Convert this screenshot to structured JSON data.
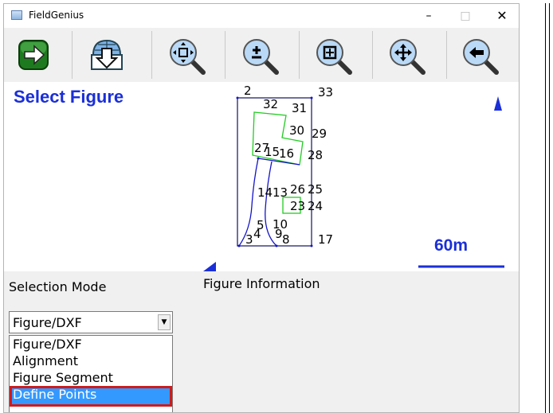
{
  "window": {
    "title": "FieldGenius"
  },
  "titlebar_buttons": {
    "minimize": "–",
    "maximize": "□",
    "close": "✕"
  },
  "toolbar": {
    "buttons": [
      {
        "name": "forward-arrow-icon"
      },
      {
        "name": "download-globe-icon"
      },
      {
        "name": "zoom-extents-icon"
      },
      {
        "name": "zoom-in-out-icon"
      },
      {
        "name": "zoom-window-icon"
      },
      {
        "name": "pan-icon"
      },
      {
        "name": "zoom-previous-icon"
      }
    ]
  },
  "map": {
    "heading": "Select Figure",
    "scale_label": "60m",
    "point_labels": [
      "2",
      "33",
      "32",
      "31",
      "30",
      "29",
      "27",
      "15",
      "16",
      "28",
      "14",
      "13",
      "26",
      "25",
      "23",
      "24",
      "5",
      "10",
      "4",
      "9",
      "3",
      "8",
      "17"
    ],
    "colors": {
      "heading": "#1a2fd8",
      "figure": "#1414c8",
      "highlight": "#22cc22",
      "outline": "#101060"
    }
  },
  "panel": {
    "selection_mode_label": "Selection Mode",
    "figure_info_label": "Figure Information",
    "combo_value": "Figure/DXF",
    "options": [
      "Figure/DXF",
      "Alignment",
      "Figure Segment",
      "Define Points"
    ],
    "selected_option": "Define Points"
  }
}
